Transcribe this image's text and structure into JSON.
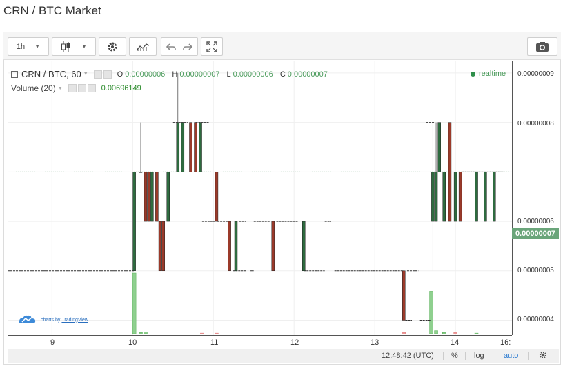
{
  "page": {
    "title": "CRN / BTC Market"
  },
  "toolbar": {
    "interval": "1h",
    "undo_label": "",
    "redo_label": ""
  },
  "legend": {
    "symbol": "CRN / BTC, 60",
    "ohlc": {
      "o_label": "O",
      "o": "0.00000006",
      "h_label": "H",
      "h": "0.00000007",
      "l_label": "L",
      "l": "0.00000006",
      "c_label": "C",
      "c": "0.00000007"
    },
    "volume_label": "Volume (20)",
    "volume_value": "0.00696149",
    "realtime": "realtime"
  },
  "price_axis": {
    "labels": [
      "0.00000009",
      "0.00000008",
      "0.00000006",
      "0.00000005",
      "0.00000004"
    ],
    "current_price": "0.00000007"
  },
  "time_axis": {
    "labels": [
      "9",
      "10",
      "11",
      "12",
      "13",
      "14",
      "16:"
    ]
  },
  "statusbar": {
    "time": "12:48:42 (UTC)",
    "percent": "%",
    "log": "log",
    "auto": "auto"
  },
  "branding": {
    "text_prefix": "charts by",
    "text_link": "TradingView"
  },
  "colors": {
    "up": "#2e6b3f",
    "down": "#9b3a2a",
    "volume_up": "#8fd08f",
    "volume_down": "#f0a0a0",
    "accent": "#4a9b5b"
  },
  "chart_data": {
    "type": "candlestick",
    "price_range": [
      3.7e-08,
      9.25e-08
    ],
    "days_range": [
      8.45,
      14.7
    ],
    "candles": [
      {
        "t": 10.02,
        "o": 5e-08,
        "h": 7e-08,
        "l": 5e-08,
        "c": 7e-08
      },
      {
        "t": 10.1,
        "o": 7e-08,
        "h": 8e-08,
        "l": 7e-08,
        "c": 7e-08
      },
      {
        "t": 10.16,
        "o": 7e-08,
        "h": 7e-08,
        "l": 6e-08,
        "c": 6e-08
      },
      {
        "t": 10.2,
        "o": 7e-08,
        "h": 7e-08,
        "l": 6e-08,
        "c": 6e-08
      },
      {
        "t": 10.24,
        "o": 6e-08,
        "h": 7e-08,
        "l": 6e-08,
        "c": 7e-08
      },
      {
        "t": 10.3,
        "o": 7e-08,
        "h": 7e-08,
        "l": 6e-08,
        "c": 6e-08
      },
      {
        "t": 10.34,
        "o": 6e-08,
        "h": 6e-08,
        "l": 5e-08,
        "c": 5e-08
      },
      {
        "t": 10.38,
        "o": 6e-08,
        "h": 6e-08,
        "l": 5e-08,
        "c": 5e-08
      },
      {
        "t": 10.44,
        "o": 6e-08,
        "h": 7e-08,
        "l": 6e-08,
        "c": 7e-08
      },
      {
        "t": 10.56,
        "o": 7e-08,
        "h": 9e-08,
        "l": 7e-08,
        "c": 8e-08
      },
      {
        "t": 10.62,
        "o": 7e-08,
        "h": 8e-08,
        "l": 7e-08,
        "c": 8e-08
      },
      {
        "t": 10.72,
        "o": 8e-08,
        "h": 8e-08,
        "l": 7e-08,
        "c": 7e-08
      },
      {
        "t": 10.78,
        "o": 8e-08,
        "h": 8e-08,
        "l": 7e-08,
        "c": 7e-08
      },
      {
        "t": 10.84,
        "o": 7e-08,
        "h": 8e-08,
        "l": 7e-08,
        "c": 8e-08
      },
      {
        "t": 11.04,
        "o": 7e-08,
        "h": 7e-08,
        "l": 6e-08,
        "c": 6e-08
      },
      {
        "t": 11.2,
        "o": 6e-08,
        "h": 6e-08,
        "l": 5e-08,
        "c": 5e-08
      },
      {
        "t": 11.28,
        "o": 5e-08,
        "h": 6e-08,
        "l": 5e-08,
        "c": 6e-08
      },
      {
        "t": 11.74,
        "o": 6e-08,
        "h": 6e-08,
        "l": 5e-08,
        "c": 5e-08
      },
      {
        "t": 12.12,
        "o": 5e-08,
        "h": 6e-08,
        "l": 5e-08,
        "c": 6e-08
      },
      {
        "t": 13.36,
        "o": 5e-08,
        "h": 5e-08,
        "l": 4e-08,
        "c": 4e-08
      },
      {
        "t": 13.72,
        "o": 6e-08,
        "h": 8e-08,
        "l": 5e-08,
        "c": 7e-08
      },
      {
        "t": 13.76,
        "o": 6e-08,
        "h": 8e-08,
        "l": 6e-08,
        "c": 7e-08
      },
      {
        "t": 13.8,
        "o": 7e-08,
        "h": 8e-08,
        "l": 7e-08,
        "c": 8e-08
      },
      {
        "t": 13.86,
        "o": 6e-08,
        "h": 7e-08,
        "l": 6e-08,
        "c": 7e-08
      },
      {
        "t": 13.93,
        "o": 8e-08,
        "h": 8e-08,
        "l": 6e-08,
        "c": 6e-08
      },
      {
        "t": 14.0,
        "o": 6e-08,
        "h": 7e-08,
        "l": 6e-08,
        "c": 7e-08
      },
      {
        "t": 14.06,
        "o": 7e-08,
        "h": 7e-08,
        "l": 6e-08,
        "c": 6e-08
      },
      {
        "t": 14.26,
        "o": 6e-08,
        "h": 7e-08,
        "l": 6e-08,
        "c": 7e-08
      },
      {
        "t": 14.37,
        "o": 6e-08,
        "h": 7e-08,
        "l": 6e-08,
        "c": 7e-08
      },
      {
        "t": 14.48,
        "o": 6e-08,
        "h": 7e-08,
        "l": 6e-08,
        "c": 7e-08
      }
    ],
    "dashes": [
      {
        "t1": 8.45,
        "t2": 10.02,
        "p": 5e-08
      },
      {
        "t1": 10.5,
        "t2": 10.68,
        "p": 8e-08
      },
      {
        "t1": 10.78,
        "t2": 10.95,
        "p": 8e-08
      },
      {
        "t1": 10.86,
        "t2": 11.03,
        "p": 6e-08
      },
      {
        "t1": 11.05,
        "t2": 11.18,
        "p": 6e-08
      },
      {
        "t1": 11.32,
        "t2": 11.4,
        "p": 6e-08
      },
      {
        "t1": 11.5,
        "t2": 11.7,
        "p": 6e-08
      },
      {
        "t1": 11.78,
        "t2": 12.05,
        "p": 6e-08
      },
      {
        "t1": 11.24,
        "t2": 11.4,
        "p": 5e-08
      },
      {
        "t1": 11.46,
        "t2": 11.5,
        "p": 5e-08
      },
      {
        "t1": 12.12,
        "t2": 12.38,
        "p": 5e-08
      },
      {
        "t1": 12.38,
        "t2": 12.46,
        "p": 6e-08
      },
      {
        "t1": 12.5,
        "t2": 13.36,
        "p": 5e-08
      },
      {
        "t1": 13.4,
        "t2": 13.54,
        "p": 5e-08
      },
      {
        "t1": 13.38,
        "t2": 13.46,
        "p": 4e-08
      },
      {
        "t1": 13.56,
        "t2": 13.7,
        "p": 4e-08
      },
      {
        "t1": 13.64,
        "t2": 13.74,
        "p": 8e-08
      },
      {
        "t1": 14.08,
        "t2": 14.6,
        "p": 7e-08
      }
    ],
    "volume": [
      {
        "t": 10.02,
        "v": 1.0,
        "dir": "up"
      },
      {
        "t": 10.1,
        "v": 0.02,
        "dir": "up"
      },
      {
        "t": 10.16,
        "v": 0.03,
        "dir": "up"
      },
      {
        "t": 10.86,
        "v": 0.01,
        "dir": "down"
      },
      {
        "t": 11.04,
        "v": 0.01,
        "dir": "down"
      },
      {
        "t": 13.36,
        "v": 0.02,
        "dir": "down"
      },
      {
        "t": 13.7,
        "v": 0.7,
        "dir": "up"
      },
      {
        "t": 13.76,
        "v": 0.05,
        "dir": "up"
      },
      {
        "t": 13.86,
        "v": 0.02,
        "dir": "up"
      },
      {
        "t": 14.0,
        "v": 0.02,
        "dir": "down"
      },
      {
        "t": 14.26,
        "v": 0.01,
        "dir": "up"
      }
    ],
    "volume_max": 0.00696149,
    "current_price": 7e-08
  }
}
